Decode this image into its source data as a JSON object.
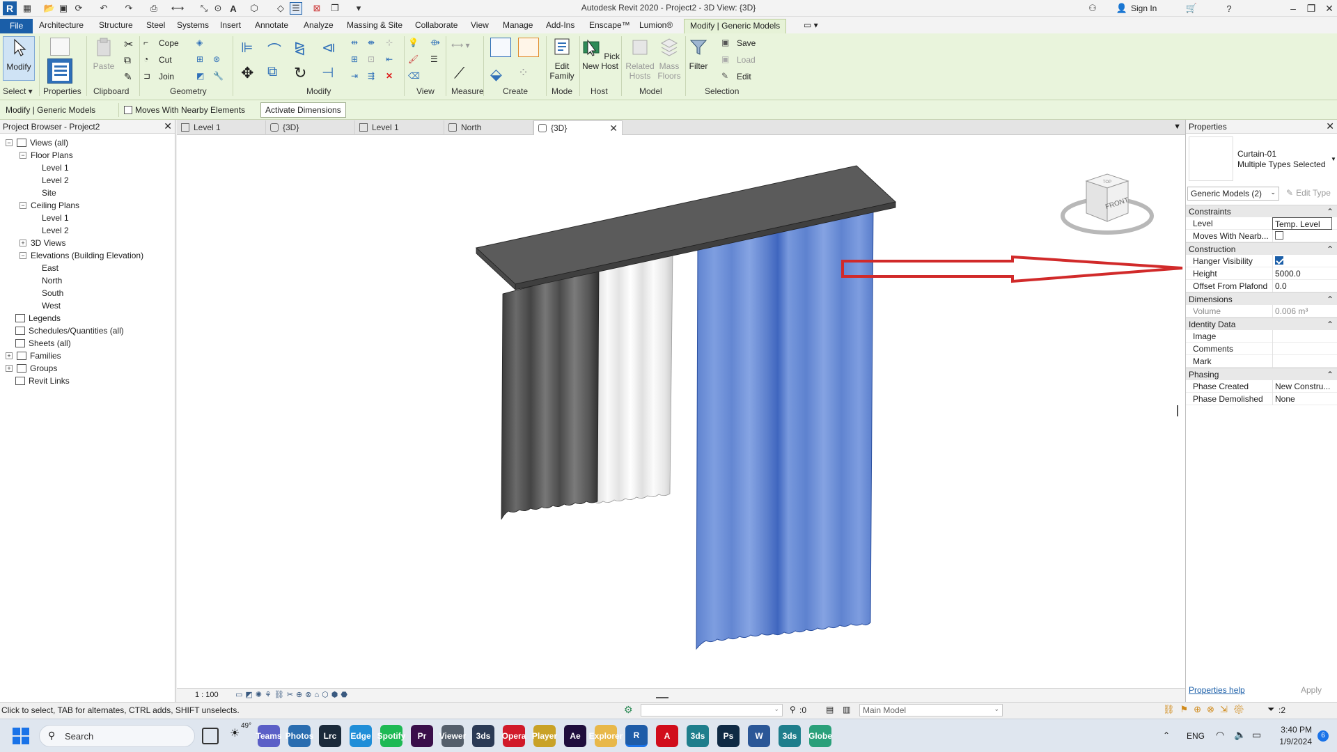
{
  "window": {
    "title": "Autodesk Revit 2020 - Project2 - 3D View: {3D}",
    "sign_in": "Sign In"
  },
  "ribbon_tabs": [
    "File",
    "Architecture",
    "Structure",
    "Steel",
    "Systems",
    "Insert",
    "Annotate",
    "Analyze",
    "Massing & Site",
    "Collaborate",
    "View",
    "Manage",
    "Add-Ins",
    "Enscape™",
    "Lumion®",
    "Modify | Generic Models"
  ],
  "ribbon": {
    "modify_label": "Modify",
    "properties_label": "Properties",
    "paste_label": "Paste",
    "cope_label": "Cope",
    "cut_label": "Cut",
    "join_label": "Join",
    "edit_family_label": "Edit Family",
    "pick_new_host_label": "Pick New Host",
    "related_hosts_label": "Related Hosts",
    "mass_floors_label": "Mass Floors",
    "filter_label": "Filter",
    "save_label": "Save",
    "load_label": "Load",
    "edit_label": "Edit",
    "panels": {
      "select": "Select ▾",
      "properties": "Properties",
      "clipboard": "Clipboard",
      "geometry": "Geometry",
      "modify": "Modify",
      "view": "View",
      "measure": "Measure",
      "create": "Create",
      "mode": "Mode",
      "host": "Host",
      "model": "Model",
      "selection": "Selection"
    }
  },
  "options_bar": {
    "context": "Modify | Generic Models",
    "moves_with_nearby": "Moves With Nearby Elements",
    "activate_dimensions": "Activate Dimensions"
  },
  "project_browser": {
    "title": "Project Browser - Project2",
    "items": [
      {
        "label": "Views (all)",
        "level": 0,
        "toggle": "−"
      },
      {
        "label": "Floor Plans",
        "level": 1,
        "toggle": "−"
      },
      {
        "label": "Level 1",
        "level": 2,
        "toggle": ""
      },
      {
        "label": "Level 2",
        "level": 2,
        "toggle": ""
      },
      {
        "label": "Site",
        "level": 2,
        "toggle": ""
      },
      {
        "label": "Ceiling Plans",
        "level": 1,
        "toggle": "−"
      },
      {
        "label": "Level 1",
        "level": 2,
        "toggle": ""
      },
      {
        "label": "Level 2",
        "level": 2,
        "toggle": ""
      },
      {
        "label": "3D Views",
        "level": 1,
        "toggle": "+"
      },
      {
        "label": "Elevations (Building Elevation)",
        "level": 1,
        "toggle": "−"
      },
      {
        "label": "East",
        "level": 2,
        "toggle": ""
      },
      {
        "label": "North",
        "level": 2,
        "toggle": ""
      },
      {
        "label": "South",
        "level": 2,
        "toggle": ""
      },
      {
        "label": "West",
        "level": 2,
        "toggle": ""
      },
      {
        "label": "Legends",
        "level": 0,
        "toggle": ""
      },
      {
        "label": "Schedules/Quantities (all)",
        "level": 0,
        "toggle": ""
      },
      {
        "label": "Sheets (all)",
        "level": 0,
        "toggle": ""
      },
      {
        "label": "Families",
        "level": 0,
        "toggle": "+"
      },
      {
        "label": "Groups",
        "level": 0,
        "toggle": "+"
      },
      {
        "label": "Revit Links",
        "level": 0,
        "toggle": ""
      }
    ]
  },
  "view_tabs": [
    "Level 1",
    "{3D}",
    "Level 1",
    "North",
    "{3D}"
  ],
  "view": {
    "scale": "1 : 100",
    "viewcube_face": "FRONT",
    "viewcube_top": "TOP"
  },
  "properties": {
    "title": "Properties",
    "family": "Curtain-01",
    "selection_info": "Multiple Types Selected",
    "type_selector": "Generic Models (2)",
    "edit_type": "Edit Type",
    "sections": {
      "constraints": "Constraints",
      "construction": "Construction",
      "dimensions": "Dimensions",
      "identity": "Identity Data",
      "phasing": "Phasing"
    },
    "rows": {
      "level": {
        "label": "Level",
        "value": "Temp. Level"
      },
      "moves_with": {
        "label": "Moves With Nearb...",
        "value": ""
      },
      "hanger_visibility": {
        "label": "Hanger Visibility",
        "value": ""
      },
      "height": {
        "label": "Height",
        "value": "5000.0"
      },
      "offset": {
        "label": "Offset From Plafond",
        "value": "0.0"
      },
      "volume": {
        "label": "Volume",
        "value": "0.006 m³"
      },
      "image": {
        "label": "Image",
        "value": ""
      },
      "comments": {
        "label": "Comments",
        "value": ""
      },
      "mark": {
        "label": "Mark",
        "value": ""
      },
      "phase_created": {
        "label": "Phase Created",
        "value": "New Constru..."
      },
      "phase_demolished": {
        "label": "Phase Demolished",
        "value": "None"
      }
    },
    "help_link": "Properties help",
    "apply": "Apply"
  },
  "statusbar": {
    "hint": "Click to select, TAB for alternates, CTRL adds, SHIFT unselects.",
    "workset_count": ":0",
    "model": "Main Model",
    "filter_count": ":2"
  },
  "taskbar": {
    "search": "Search",
    "weather": "49°",
    "lang": "ENG",
    "time": "3:40 PM",
    "date": "1/9/2024",
    "notifications": "6",
    "apps": [
      "Teams",
      "Photos",
      "Lrc",
      "Edge",
      "Spotify",
      "Pr",
      "Viewer",
      "3ds",
      "Opera",
      "Player",
      "Ae",
      "Explorer",
      "R",
      "A",
      "3ds",
      "Ps",
      "W",
      "3ds",
      "Globe"
    ],
    "app_colors": [
      "#5b5fc7",
      "#2a6db0",
      "#1b2a3a",
      "#1f8ed8",
      "#1db954",
      "#3a0f4a",
      "#555f6b",
      "#2b3a55",
      "#d11a2a",
      "#c9a227",
      "#1f0e3d",
      "#e8b84a",
      "#1e5ca8",
      "#d10d1c",
      "#1e7e8c",
      "#0f2a44",
      "#2b5797",
      "#1e7e8c",
      "#2aa07a"
    ]
  },
  "colors": {
    "ribbon_bg": "#e9f4dc",
    "accent": "#1a5ea8",
    "arrow": "#d12a2a",
    "curtain_blue": "#6d8fd6",
    "curtain_dark": "#4a4a4a",
    "curtain_white": "#f2f2f2"
  }
}
